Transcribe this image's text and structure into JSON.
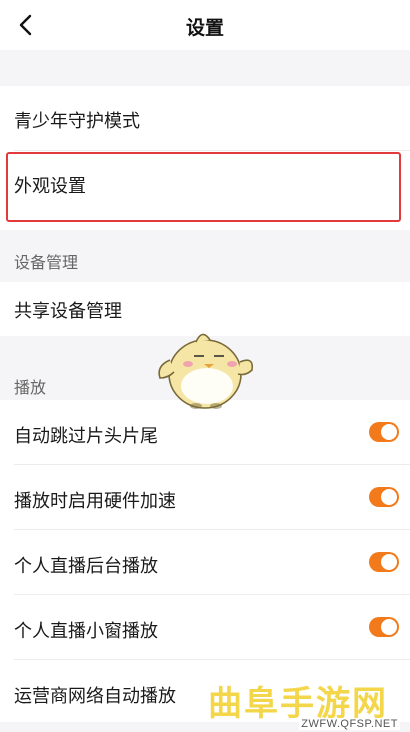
{
  "header": {
    "title": "设置",
    "back_icon": "chevron-left-icon"
  },
  "rows": {
    "teen_mode": "青少年守护模式",
    "appearance": "外观设置"
  },
  "sections": {
    "device": {
      "title": "设备管理",
      "items": [
        "共享设备管理"
      ]
    },
    "playback": {
      "title": "播放",
      "items": [
        {
          "label": "自动跳过片头片尾",
          "on": true
        },
        {
          "label": "播放时启用硬件加速",
          "on": true
        },
        {
          "label": "个人直播后台播放",
          "on": true
        },
        {
          "label": "个人直播小窗播放",
          "on": true
        },
        {
          "label": "运营商网络自动播放",
          "on": true
        }
      ]
    }
  },
  "colors": {
    "toggle_on": "#f27a1a",
    "highlight": "#e23a3a"
  },
  "watermark": {
    "main": "曲阜手游网",
    "sub": "ZWFW.QFSP.NET"
  }
}
